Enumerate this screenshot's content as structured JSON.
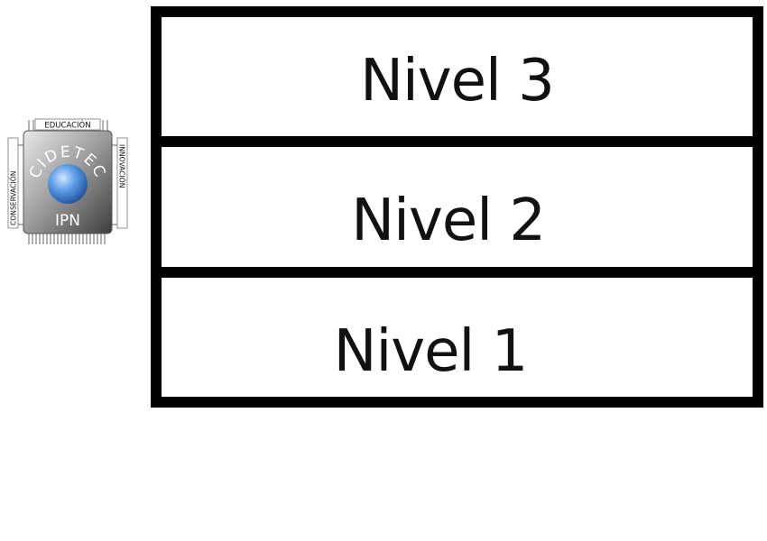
{
  "logo": {
    "icon": "cidetec-ipn-logo",
    "top_text": "EDUCACIÓN",
    "left_text": "CONSERVACIÓN",
    "right_text": "INNOVACIÓN",
    "ring_text": "CIDETEC",
    "bottom_text": "IPN",
    "colors": {
      "chip": "#6e6e6e",
      "sphere": "#4f8fe0",
      "pins": "#9a9a9a"
    }
  },
  "levels": [
    {
      "id": "nivel-3",
      "label": "Nivel 3"
    },
    {
      "id": "nivel-2",
      "label": "Nivel 2"
    },
    {
      "id": "nivel-1",
      "label": "Nivel 1"
    }
  ]
}
